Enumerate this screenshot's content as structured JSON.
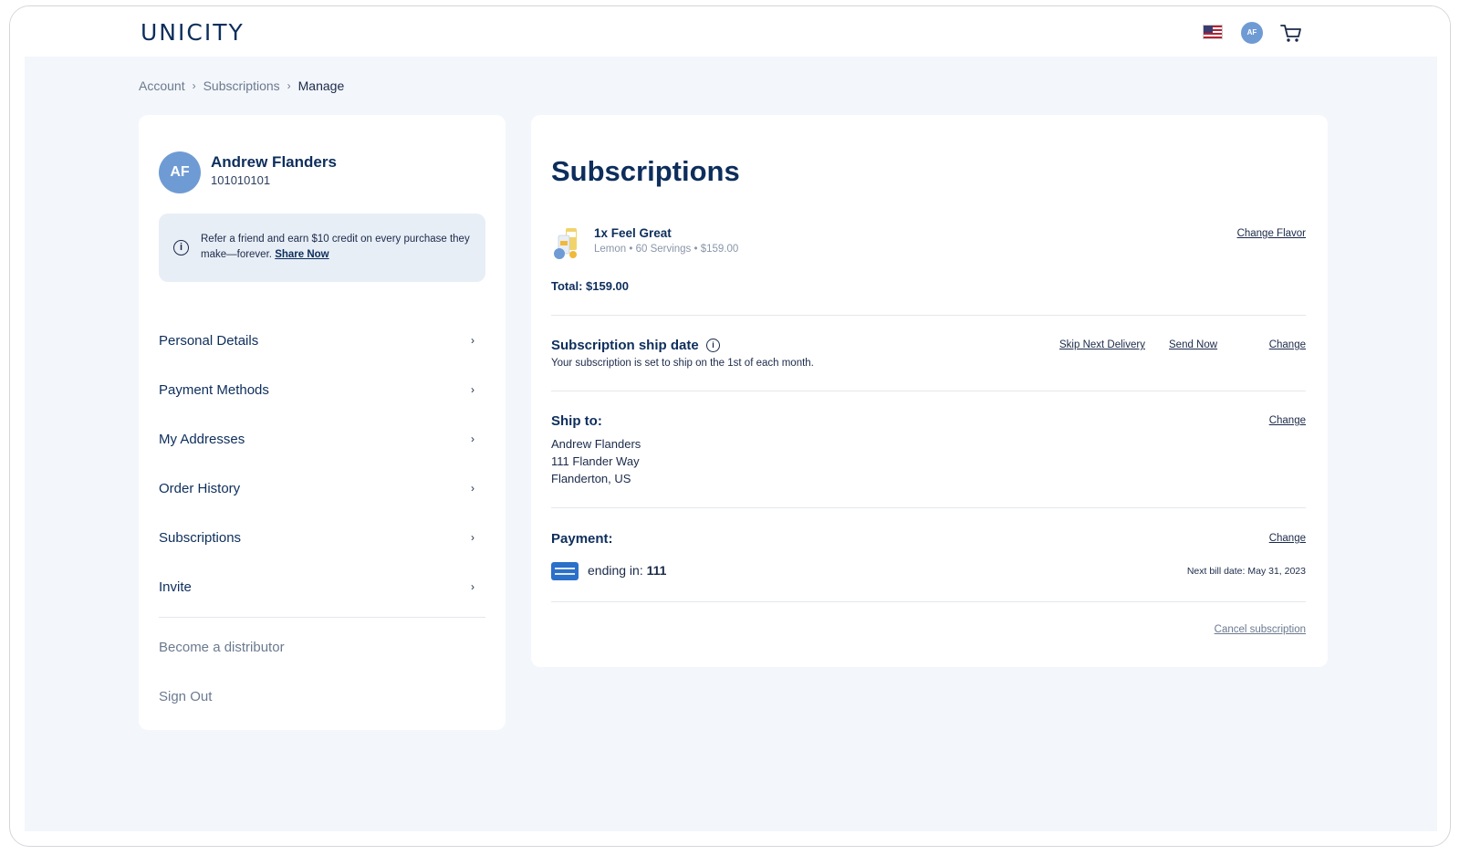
{
  "header": {
    "logo": "UNICITY",
    "avatar_initials": "AF"
  },
  "breadcrumb": [
    {
      "label": "Account"
    },
    {
      "label": "Subscriptions"
    },
    {
      "label": "Manage"
    }
  ],
  "profile": {
    "initials": "AF",
    "name": "Andrew Flanders",
    "id": "101010101"
  },
  "referral": {
    "text": "Refer a friend and earn $10 credit on every purchase they make—forever.",
    "link": "Share Now"
  },
  "menu": [
    {
      "label": "Personal Details"
    },
    {
      "label": "Payment Methods"
    },
    {
      "label": "My Addresses"
    },
    {
      "label": "Order History"
    },
    {
      "label": "Subscriptions"
    },
    {
      "label": "Invite"
    }
  ],
  "secondary_links": {
    "distributor": "Become a distributor",
    "sign_out": "Sign Out"
  },
  "subscription": {
    "title": "Subscriptions",
    "product": {
      "name": "1x Feel Great",
      "meta": "Lemon • 60 Servings • $159.00",
      "change_flavor": "Change Flavor"
    },
    "total": "Total: $159.00",
    "ship_date": {
      "title": "Subscription ship date",
      "description": "Your subscription is set to ship on the 1st of each month.",
      "skip": "Skip Next Delivery",
      "send_now": "Send Now",
      "change": "Change"
    },
    "ship_to": {
      "title": "Ship to:",
      "change": "Change",
      "lines": [
        "Andrew Flanders",
        "111 Flander Way",
        "Flanderton, US"
      ]
    },
    "payment": {
      "title": "Payment:",
      "change": "Change",
      "ending_label": "ending in: ",
      "ending_digits": "111",
      "next_bill": "Next bill date: May 31, 2023"
    },
    "cancel": "Cancel subscription"
  }
}
